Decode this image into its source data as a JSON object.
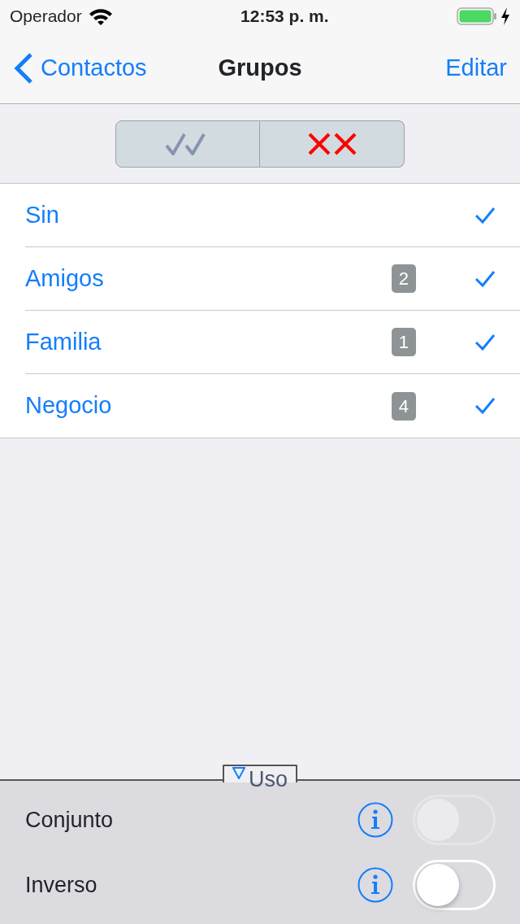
{
  "status_bar": {
    "carrier": "Operador",
    "time": "12:53 p. m.",
    "charging": true
  },
  "nav": {
    "back": "Contactos",
    "title": "Grupos",
    "action": "Editar"
  },
  "groups": [
    {
      "name": "Sin",
      "checked": true
    },
    {
      "name": "Amigos",
      "count": "2",
      "checked": true
    },
    {
      "name": "Familia",
      "count": "1",
      "checked": true
    },
    {
      "name": "Negocio",
      "count": "4",
      "checked": true
    }
  ],
  "panel": {
    "tab": "Uso",
    "expanded": true,
    "options": [
      {
        "label": "Conjunto",
        "on": false,
        "disabled": true
      },
      {
        "label": "Inverso",
        "on": false,
        "disabled": false
      }
    ]
  }
}
